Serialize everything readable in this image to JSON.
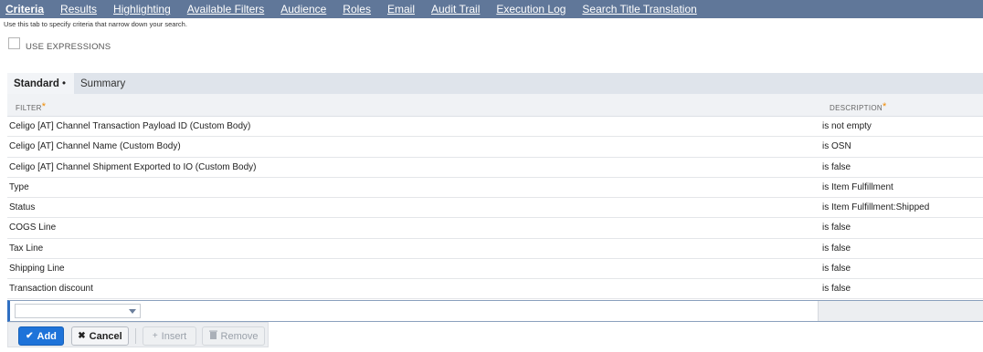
{
  "tabs": [
    {
      "label": "Criteria",
      "active": true
    },
    {
      "label": "Results"
    },
    {
      "label": "Highlighting"
    },
    {
      "label": "Available Filters"
    },
    {
      "label": "Audience"
    },
    {
      "label": "Roles"
    },
    {
      "label": "Email"
    },
    {
      "label": "Audit Trail"
    },
    {
      "label": "Execution Log"
    },
    {
      "label": "Search Title Translation"
    }
  ],
  "hint": "Use this tab to specify criteria that narrow down your search.",
  "use_expressions": {
    "label": "USE EXPRESSIONS",
    "checked": false
  },
  "subtabs": {
    "standard": "Standard",
    "standard_marker": "•",
    "summary": "Summary"
  },
  "table": {
    "filter_header": "FILTER",
    "description_header": "DESCRIPTION",
    "required_mark": "*",
    "rows": [
      {
        "filter": "Celigo [AT] Channel Transaction Payload ID (Custom Body)",
        "description": "is not empty"
      },
      {
        "filter": "Celigo [AT] Channel Name (Custom Body)",
        "description": "is OSN"
      },
      {
        "filter": "Celigo [AT] Channel Shipment Exported to IO (Custom Body)",
        "description": "is false"
      },
      {
        "filter": "Type",
        "description": "is Item Fulfillment"
      },
      {
        "filter": "Status",
        "description": "is Item Fulfillment:Shipped"
      },
      {
        "filter": "COGS Line",
        "description": "is false"
      },
      {
        "filter": "Tax Line",
        "description": "is false"
      },
      {
        "filter": "Shipping Line",
        "description": "is false"
      },
      {
        "filter": "Transaction discount",
        "description": "is false"
      }
    ]
  },
  "buttons": {
    "add": "Add",
    "cancel": "Cancel",
    "insert": "Insert",
    "remove": "Remove"
  },
  "colors": {
    "nav_bg": "#607799",
    "primary_button": "#1e73d9",
    "required": "#f08a00"
  },
  "icons": {
    "add": "check-icon",
    "cancel": "x-icon",
    "insert": "plus-icon",
    "remove": "trash-icon"
  }
}
